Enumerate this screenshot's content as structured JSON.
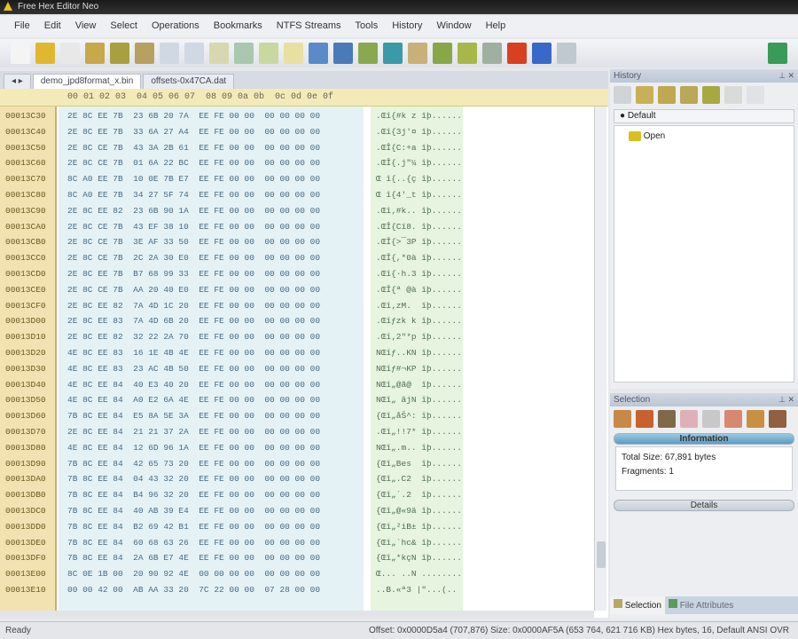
{
  "window": {
    "title": "Free Hex Editor Neo"
  },
  "menu": [
    "File",
    "Edit",
    "View",
    "Select",
    "Operations",
    "Bookmarks",
    "NTFS Streams",
    "Tools",
    "History",
    "Window",
    "Help"
  ],
  "toolbar_icons": [
    {
      "name": "new-file-icon",
      "color": "#f4f4f4"
    },
    {
      "name": "open-folder-icon",
      "color": "#e0b830"
    },
    {
      "name": "recent-icon",
      "color": "#e8e8e8"
    },
    {
      "name": "save-icon",
      "color": "#c8a848"
    },
    {
      "name": "save-all-icon",
      "color": "#a8a040"
    },
    {
      "name": "print-icon",
      "color": "#b8a060"
    },
    {
      "name": "cut-icon",
      "color": "#d0d8e4"
    },
    {
      "name": "copy-icon",
      "color": "#d0d8e4"
    },
    {
      "name": "paste-icon",
      "color": "#d8d8b0"
    },
    {
      "name": "paste-special-icon",
      "color": "#a8c8b0"
    },
    {
      "name": "clipboard-icon",
      "color": "#c8d8a0"
    },
    {
      "name": "bookmark-icon",
      "color": "#e8e0a0"
    },
    {
      "name": "find-icon",
      "color": "#5a8ac8"
    },
    {
      "name": "find-next-icon",
      "color": "#4a7ab8"
    },
    {
      "name": "replace-icon",
      "color": "#8aa850"
    },
    {
      "name": "goto-icon",
      "color": "#3a9aa8"
    },
    {
      "name": "home-icon",
      "color": "#c8b078"
    },
    {
      "name": "history-back-icon",
      "color": "#88a848"
    },
    {
      "name": "history-forward-icon",
      "color": "#a8b848"
    },
    {
      "name": "refresh-icon",
      "color": "#a0b0a0"
    },
    {
      "name": "calculator-icon",
      "color": "#d84020"
    },
    {
      "name": "pin-icon",
      "color": "#3a68c8"
    },
    {
      "name": "layout-icon",
      "color": "#c0c8d0"
    },
    {
      "name": "settings-icon",
      "color": "#3a9a5a"
    }
  ],
  "tabs": [
    {
      "label": "demo_jpd8format_x.bin"
    },
    {
      "label": "offsets-0x47CA.dat"
    }
  ],
  "tab_nav": "◂ ▸",
  "header": "00 01 02 03  04 05 06 07  08 09 0a 0b  0c 0d 0e 0f",
  "rows": [
    {
      "o": "00013C30",
      "h": "2E 8C EE 7B  23 6B 20 7A  EE FE 00 00  00 00 00 00",
      "a": ".Œî{#k z îþ......"
    },
    {
      "o": "00013C40",
      "h": "2E 8C EE 7B  33 6A 27 A4  EE FE 00 00  00 00 00 00",
      "a": ".Œî{3j'¤ îþ......"
    },
    {
      "o": "00013C50",
      "h": "2E 8C CE 7B  43 3A 2B 61  EE FE 00 00  00 00 00 00",
      "a": ".ŒÎ{C:+a îþ......"
    },
    {
      "o": "00013C60",
      "h": "2E 8C CE 7B  01 6A 22 BC  EE FE 00 00  00 00 00 00",
      "a": ".ŒÎ{.j\"¼ îþ......"
    },
    {
      "o": "00013C70",
      "h": "8C A0 EE 7B  10 0E 7B E7  EE FE 00 00  00 00 00 00",
      "a": "Œ î{..{ç îþ......"
    },
    {
      "o": "00013C80",
      "h": "8C A0 EE 7B  34 27 5F 74  EE FE 00 00  00 00 00 00",
      "a": "Œ î{4'_t îþ......"
    },
    {
      "o": "00013C90",
      "h": "2E 8C EE 82  23 6B 90 1A  EE FE 00 00  00 00 00 00",
      "a": ".Œî‚#k.. îþ......"
    },
    {
      "o": "00013CA0",
      "h": "2E 8C CE 7B  43 EF 38 10  EE FE 00 00  00 00 00 00",
      "a": ".ŒÎ{Cï8. îþ......"
    },
    {
      "o": "00013CB0",
      "h": "2E 8C CE 7B  3E AF 33 50  EE FE 00 00  00 00 00 00",
      "a": ".ŒÎ{>¯3P îþ......"
    },
    {
      "o": "00013CC0",
      "h": "2E 8C CE 7B  2C 2A 30 E0  EE FE 00 00  00 00 00 00",
      "a": ".ŒÎ{,*0à îþ......"
    },
    {
      "o": "00013CD0",
      "h": "2E 8C EE 7B  B7 68 99 33  EE FE 00 00  00 00 00 00",
      "a": ".Œî{·h.3 îþ......"
    },
    {
      "o": "00013CE0",
      "h": "2E 8C CE 7B  AA 20 40 E0  EE FE 00 00  00 00 00 00",
      "a": ".ŒÎ{ª @à îþ......"
    },
    {
      "o": "00013CF0",
      "h": "2E 8C EE 82  7A 4D 1C 20  EE FE 00 00  00 00 00 00",
      "a": ".Œî‚zM.  îþ......"
    },
    {
      "o": "00013D00",
      "h": "2E 8C EE 83  7A 4D 6B 20  EE FE 00 00  00 00 00 00",
      "a": ".Œîƒzk k îþ......"
    },
    {
      "o": "00013D10",
      "h": "2E 8C EE 82  32 22 2A 70  EE FE 00 00  00 00 00 00",
      "a": ".Œî‚2\"*p îþ......"
    },
    {
      "o": "00013D20",
      "h": "4E 8C EE 83  16 1E 4B 4E  EE FE 00 00  00 00 00 00",
      "a": "NŒîƒ..KN îþ......"
    },
    {
      "o": "00013D30",
      "h": "4E 8C EE 83  23 AC 4B 50  EE FE 00 00  00 00 00 00",
      "a": "NŒîƒ#¬KP îþ......"
    },
    {
      "o": "00013D40",
      "h": "4E 8C EE 84  40 E3 40 20  EE FE 00 00  00 00 00 00",
      "a": "NŒî„@ã@  îþ......"
    },
    {
      "o": "00013D50",
      "h": "4E 8C EE 84  A0 E2 6A 4E  EE FE 00 00  00 00 00 00",
      "a": "NŒî„ âjN îþ......"
    },
    {
      "o": "00013D60",
      "h": "7B 8C EE 84  E5 8A 5E 3A  EE FE 00 00  00 00 00 00",
      "a": "{Œî„åŠ^: îþ......"
    },
    {
      "o": "00013D70",
      "h": "2E 8C EE 84  21 21 37 2A  EE FE 00 00  00 00 00 00",
      "a": ".Œî„!!7* îþ......"
    },
    {
      "o": "00013D80",
      "h": "4E 8C EE 84  12 6D 96 1A  EE FE 00 00  00 00 00 00",
      "a": "NŒî„.m.. îþ......"
    },
    {
      "o": "00013D90",
      "h": "7B 8C EE 84  42 65 73 20  EE FE 00 00  00 00 00 00",
      "a": "{Œî„Bes  îþ......"
    },
    {
      "o": "00013DA0",
      "h": "7B 8C EE 84  04 43 32 20  EE FE 00 00  00 00 00 00",
      "a": "{Œî„.C2  îþ......"
    },
    {
      "o": "00013DB0",
      "h": "7B 8C EE 84  B4 96 32 20  EE FE 00 00  00 00 00 00",
      "a": "{Œî„´.2  îþ......"
    },
    {
      "o": "00013DC0",
      "h": "7B 8C EE 84  40 AB 39 E4  EE FE 00 00  00 00 00 00",
      "a": "{Œî„@«9ä îþ......"
    },
    {
      "o": "00013DD0",
      "h": "7B 8C EE 84  B2 69 42 B1  EE FE 00 00  00 00 00 00",
      "a": "{Œî„²iB± îþ......"
    },
    {
      "o": "00013DE0",
      "h": "7B 8C EE 84  60 68 63 26  EE FE 00 00  00 00 00 00",
      "a": "{Œî„`hc& îþ......"
    },
    {
      "o": "00013DF0",
      "h": "7B 8C EE 84  2A 6B E7 4E  EE FE 00 00  00 00 00 00",
      "a": "{Œî„*kçN îþ......"
    },
    {
      "o": "00013E00",
      "h": "8C 0E 1B 00  20 90 92 4E  00 00 00 00  00 00 00 00",
      "a": "Œ... ..N ........"
    },
    {
      "o": "00013E10",
      "h": "00 00 42 00  AB AA 33 20  7C 22 00 00  07 28 00 00",
      "a": "..B.«ª3 |\"...(.."
    }
  ],
  "history": {
    "title": "History",
    "tab": "Default",
    "item": "Open"
  },
  "selection": {
    "title": "Selection",
    "info_label": "Information",
    "total_size_label": "Total Size:",
    "total_size_value": "67,891",
    "total_size_unit": "bytes",
    "fragments_label": "Fragments:",
    "fragments_value": "1",
    "details_label": "Details"
  },
  "bottom_tabs": [
    "Selection",
    "File Attributes"
  ],
  "status": {
    "left": "Ready",
    "right": "Offset: 0x0000D5a4 (707,876)  Size: 0x0000AF5A (653 764, 621 716 KB)  Hex bytes, 16, Default ANSI  OVR"
  }
}
